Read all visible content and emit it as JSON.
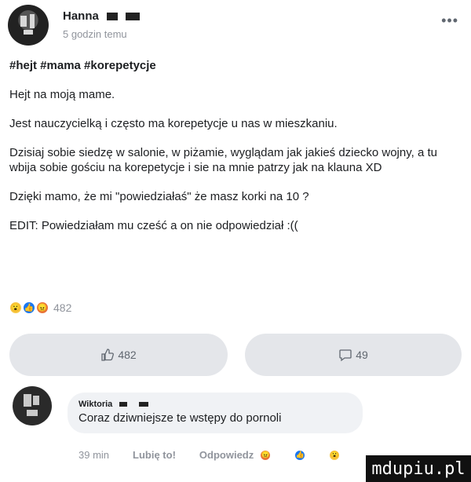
{
  "post": {
    "author": "Hanna",
    "timestamp": "5 godzin temu",
    "more_icon": "ellipsis-icon",
    "hashtags": "#hejt #mama #korepetycje",
    "paragraphs": [
      "Hejt na moją mame.",
      "Jest nauczycielką i często ma korepetycje u nas w mieszkaniu.",
      "Dzisiaj sobie siedzę w salonie, w piżamie, wyglądam jak jakieś dziecko wojny, a tu wbija sobie gościu na korepetycje i sie na mnie patrzy jak na klauna XD",
      "Dzięki mamo, że mi \"powiedziałaś\" że masz korki na 10 ?",
      "EDIT: Powiedziałam mu cześć a on nie odpowiedział :(("
    ],
    "reaction_count": "482",
    "reaction_icons": [
      "wow-reaction-icon",
      "like-reaction-icon",
      "angry-reaction-icon"
    ]
  },
  "actions": {
    "like_count": "482",
    "comment_count": "49"
  },
  "comment": {
    "author": "Wiktoria",
    "text": "Coraz dziwniejsze te wstępy do pornoli",
    "time": "39 min",
    "like_label": "Lubię to!",
    "reply_label": "Odpowiedz"
  },
  "watermark": "mdupiu.pl",
  "colors": {
    "like_blue": "#1877f2",
    "wow_yellow": "#f7c844",
    "angry_orange": "#e8723a",
    "pill_gray": "#e4e6ea",
    "meta_gray": "#90949c"
  }
}
